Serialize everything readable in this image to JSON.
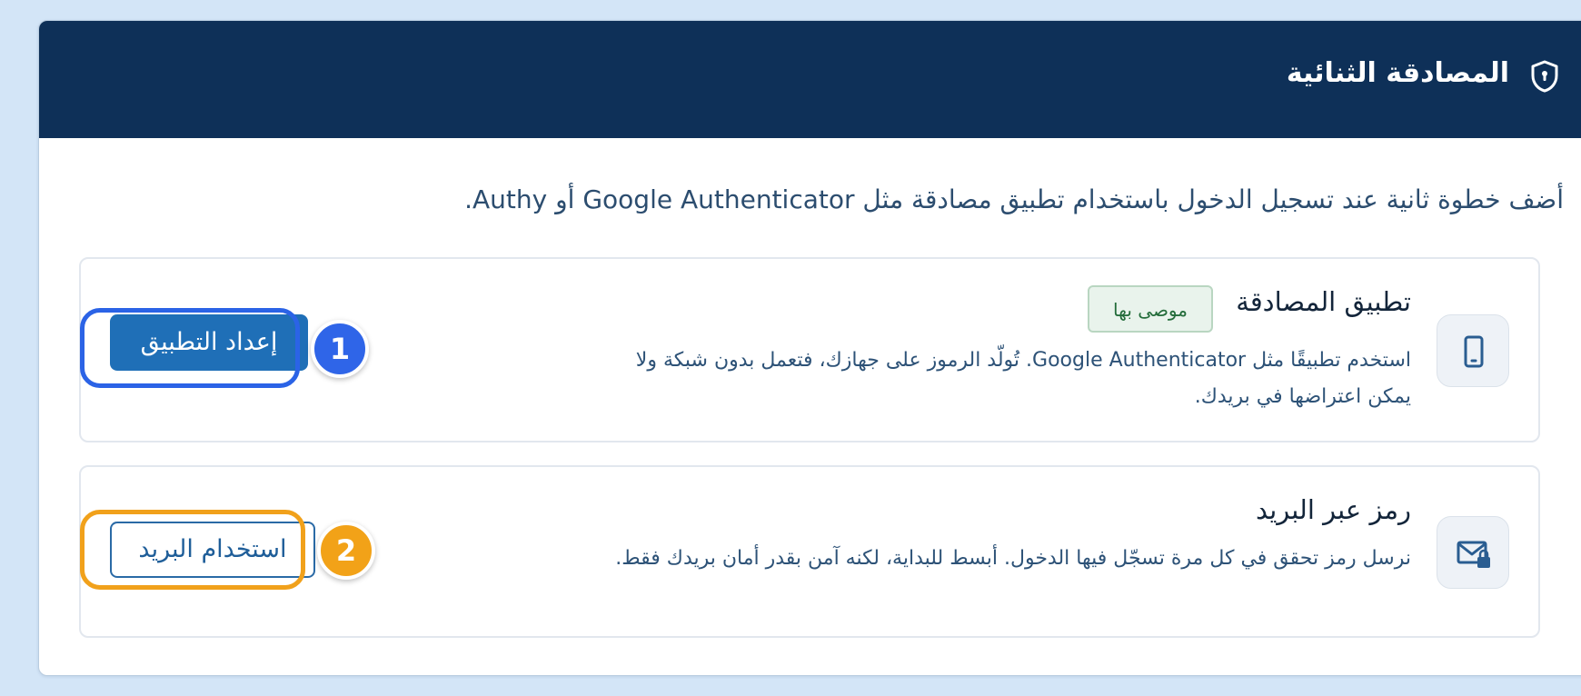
{
  "header": {
    "title": "المصادقة الثنائية",
    "icon": "shield-icon"
  },
  "intro": "أضف خطوة ثانية عند تسجيل الدخول باستخدام تطبيق مصادقة مثل Google Authenticator أو Authy.",
  "methods": [
    {
      "icon": "mobile-phone-icon",
      "title": "تطبيق المصادقة",
      "badge": "موصى بها",
      "description": "استخدم تطبيقًا مثل Google Authenticator. تُولّد الرموز على جهازك، فتعمل بدون شبكة ولا يمكن اعتراضها في بريدك.",
      "button_label": "إعداد التطبيق"
    },
    {
      "icon": "envelope-lock-icon",
      "title": "رمز عبر البريد",
      "description": "نرسل رمز تحقق في كل مرة تسجّل فيها الدخول. أبسط للبداية، لكنه آمن بقدر أمان بريدك فقط.",
      "button_label": "استخدام البريد"
    }
  ],
  "annotations": [
    {
      "number": "1",
      "color": "#2f65e8"
    },
    {
      "number": "2",
      "color": "#f2a218"
    }
  ],
  "colors": {
    "header_bg": "#0e3058",
    "primary_button": "#1f6fb7",
    "badge_text": "#236c3a",
    "page_bg": "#d3e5f7"
  }
}
